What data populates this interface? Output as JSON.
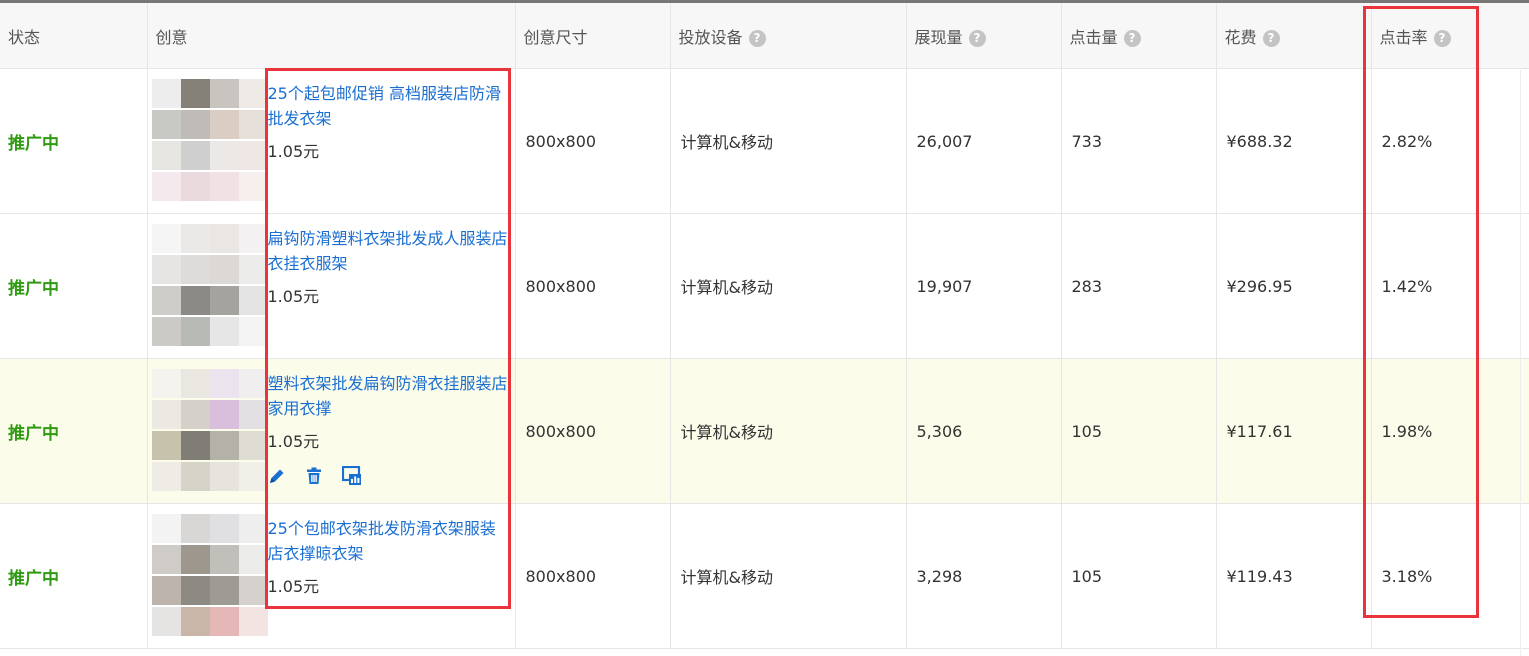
{
  "columns": [
    {
      "label": "状态",
      "help": false
    },
    {
      "label": "创意",
      "help": false
    },
    {
      "label": "创意尺寸",
      "help": false
    },
    {
      "label": "投放设备",
      "help": true
    },
    {
      "label": "展现量",
      "help": true
    },
    {
      "label": "点击量",
      "help": true
    },
    {
      "label": "花费",
      "help": true
    },
    {
      "label": "点击率",
      "help": true
    }
  ],
  "help_glyph": "?",
  "rows": [
    {
      "status": "推广中",
      "title": "25个起包邮促销 高档服装店防滑批发衣架",
      "price": "1.05元",
      "size": "800x800",
      "device": "计算机&移动",
      "impressions": "26,007",
      "clicks": "733",
      "cost": "¥688.32",
      "ctr": "2.82%",
      "highlight": false,
      "show_actions": false
    },
    {
      "status": "推广中",
      "title": "扁钩防滑塑料衣架批发成人服装店衣挂衣服架",
      "price": "1.05元",
      "size": "800x800",
      "device": "计算机&移动",
      "impressions": "19,907",
      "clicks": "283",
      "cost": "¥296.95",
      "ctr": "1.42%",
      "highlight": false,
      "show_actions": false
    },
    {
      "status": "推广中",
      "title": "塑料衣架批发扁钩防滑衣挂服装店家用衣撑",
      "price": "1.05元",
      "size": "800x800",
      "device": "计算机&移动",
      "impressions": "5,306",
      "clicks": "105",
      "cost": "¥117.61",
      "ctr": "1.98%",
      "highlight": true,
      "show_actions": true
    },
    {
      "status": "推广中",
      "title": "25个包邮衣架批发防滑衣架服装店衣撑晾衣架",
      "price": "1.05元",
      "size": "800x800",
      "device": "计算机&移动",
      "impressions": "3,298",
      "clicks": "105",
      "cost": "¥119.43",
      "ctr": "3.18%",
      "highlight": false,
      "show_actions": false
    }
  ],
  "actions": [
    "edit-icon",
    "delete-icon",
    "report-icon"
  ],
  "colors": {
    "status_green": "#2f9a12",
    "link_blue": "#1a6fd1",
    "annotation_red": "#e8343a",
    "highlight_row": "#fcfcea"
  }
}
